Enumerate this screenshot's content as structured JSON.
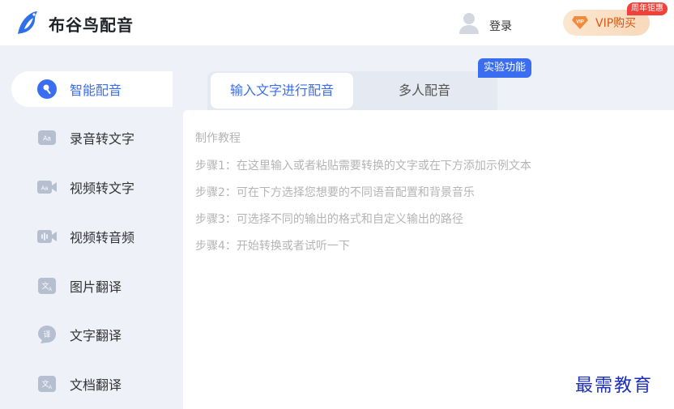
{
  "header": {
    "app_title": "布谷鸟配音",
    "login_label": "登录",
    "vip_label": "VIP购买",
    "promo_badge": "周年钜惠"
  },
  "sidebar": {
    "items": [
      {
        "label": "智能配音",
        "icon": "mic-icon",
        "active": true
      },
      {
        "label": "录音转文字",
        "icon": "audio-text-icon"
      },
      {
        "label": "视频转文字",
        "icon": "video-text-icon"
      },
      {
        "label": "视频转音频",
        "icon": "video-audio-icon"
      },
      {
        "label": "图片翻译",
        "icon": "image-translate-icon"
      },
      {
        "label": "文字翻译",
        "icon": "text-translate-icon"
      },
      {
        "label": "文档翻译",
        "icon": "doc-translate-icon"
      }
    ]
  },
  "main": {
    "tabs": [
      {
        "label": "输入文字进行配音",
        "active": true
      },
      {
        "label": "多人配音"
      }
    ],
    "experimental_badge": "实验功能",
    "tutorial": {
      "title": "制作教程",
      "steps": [
        "步骤1：在这里输入或者粘贴需要转换的文字或在下方添加示例文本",
        "步骤2：可在下方选择您想要的不同语音配置和背景音乐",
        "步骤3：可选择不同的输出的格式和自定义输出的路径",
        "步骤4：开始转换或者试听一下"
      ]
    }
  },
  "watermark": "最需教育",
  "colors": {
    "accent": "#3a6df0",
    "sidebar_bg": "#eef1f8",
    "vip_text": "#d25a1a",
    "promo_badge": "#f0423a",
    "placeholder_text": "#b4b4b4"
  }
}
